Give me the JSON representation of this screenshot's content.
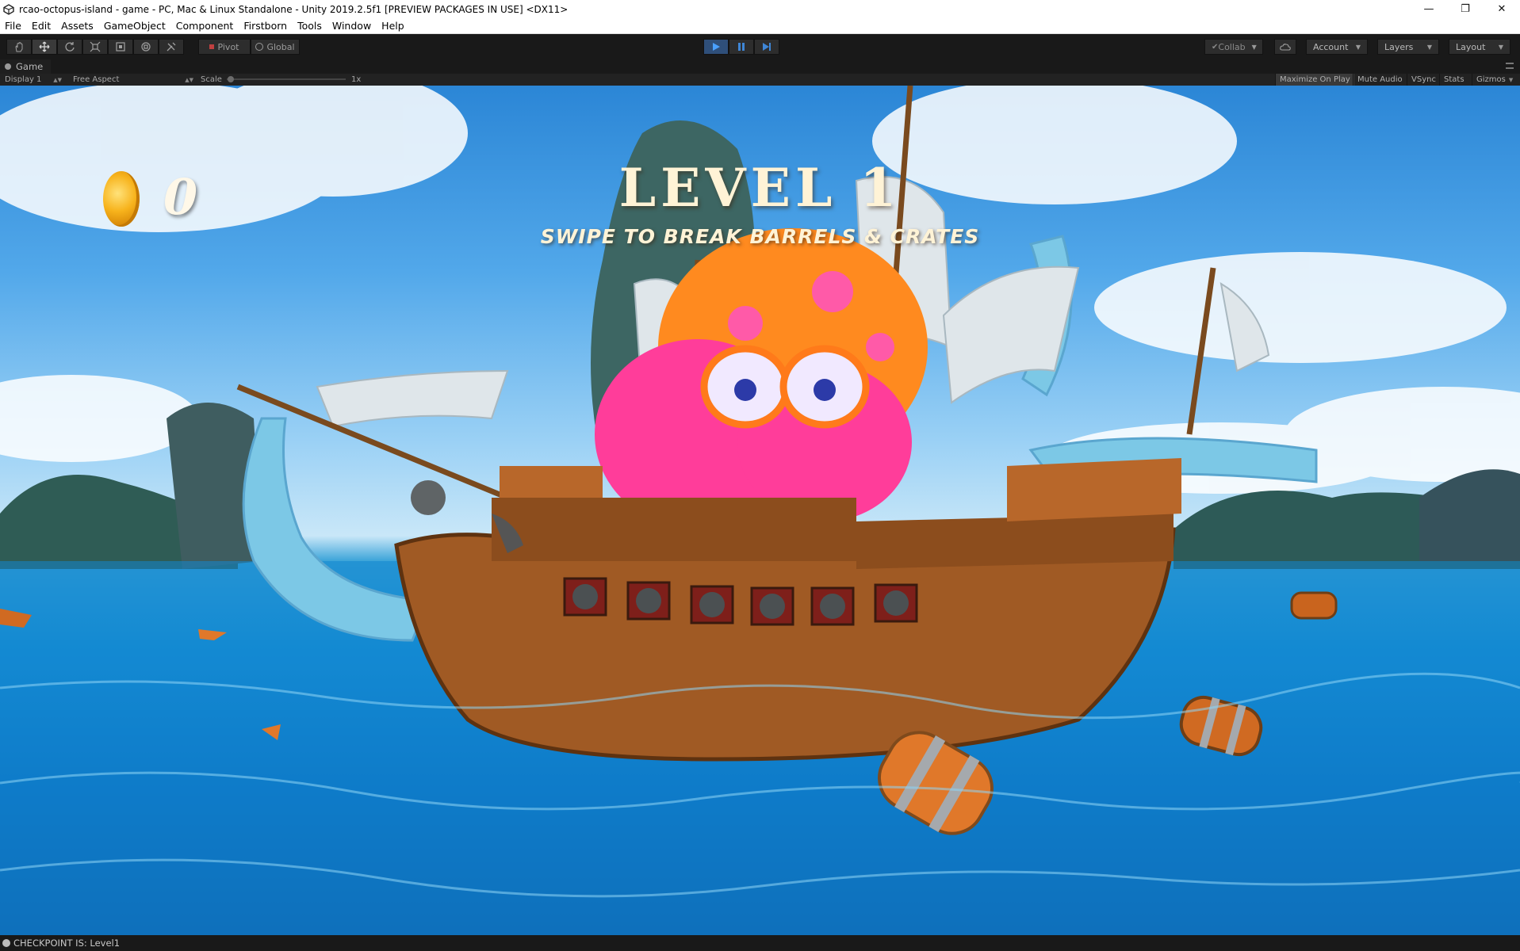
{
  "window": {
    "title": "rcao-octopus-island - game - PC, Mac & Linux Standalone - Unity 2019.2.5f1 [PREVIEW PACKAGES IN USE] <DX11>",
    "minimize": "—",
    "maximize": "❐",
    "close": "✕"
  },
  "menu": {
    "items": [
      "File",
      "Edit",
      "Assets",
      "GameObject",
      "Component",
      "Firstborn",
      "Tools",
      "Window",
      "Help"
    ]
  },
  "toolbar": {
    "pivot_label": "Pivot",
    "global_label": "Global",
    "collab_label": "Collab",
    "account_label": "Account",
    "layers_label": "Layers",
    "layout_label": "Layout",
    "accent_color": "#2f4f7a"
  },
  "game_view": {
    "tab_label": "Game",
    "display_label": "Display 1",
    "aspect_label": "Free Aspect",
    "scale_label": "Scale",
    "scale_value": "1x",
    "maximize_on_play": "Maximize On Play",
    "mute_audio": "Mute Audio",
    "vsync": "VSync",
    "stats": "Stats",
    "gizmos": "Gizmos"
  },
  "hud": {
    "coin_count": "0",
    "level_title": "LEVEL 1",
    "level_subtitle": "SWIPE TO BREAK BARRELS & CRATES"
  },
  "status": {
    "message": "CHECKPOINT IS: Level1"
  }
}
